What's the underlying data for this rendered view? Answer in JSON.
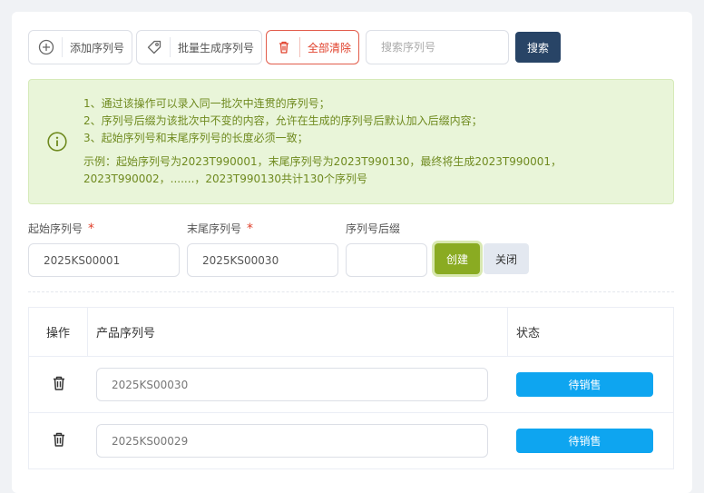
{
  "toolbar": {
    "add_label": "添加序列号",
    "batch_label": "批量生成序列号",
    "clear_label": "全部清除",
    "search_placeholder": "搜索序列号",
    "search_button": "搜索"
  },
  "notice": {
    "lines": [
      "1、通过该操作可以录入同一批次中连贯的序列号；",
      "2、序列号后缀为该批次中不变的内容，允许在生成的序列号后默认加入后缀内容；",
      "3、起始序列号和末尾序列号的长度必须一致；"
    ],
    "example": "示例：起始序列号为2023T990001，末尾序列号为2023T990130，最终将生成2023T990001，2023T990002，.......，2023T990130共计130个序列号"
  },
  "form": {
    "start_label": "起始序列号",
    "end_label": "末尾序列号",
    "suffix_label": "序列号后缀",
    "required_mark": "*",
    "start_value": "2025KS00001",
    "end_value": "2025KS00030",
    "suffix_value": "",
    "create_button": "创建",
    "close_button": "关闭"
  },
  "table": {
    "headers": [
      "操作",
      "产品序列号",
      "状态"
    ],
    "rows": [
      {
        "serial": "2025KS00030",
        "status": "待销售"
      },
      {
        "serial": "2025KS00029",
        "status": "待销售"
      }
    ]
  },
  "colors": {
    "primary_dark": "#284466",
    "success": "#8aab22",
    "danger": "#e0402b",
    "status_blue": "#0ea5f0",
    "notice_bg": "#e9f5d9"
  }
}
